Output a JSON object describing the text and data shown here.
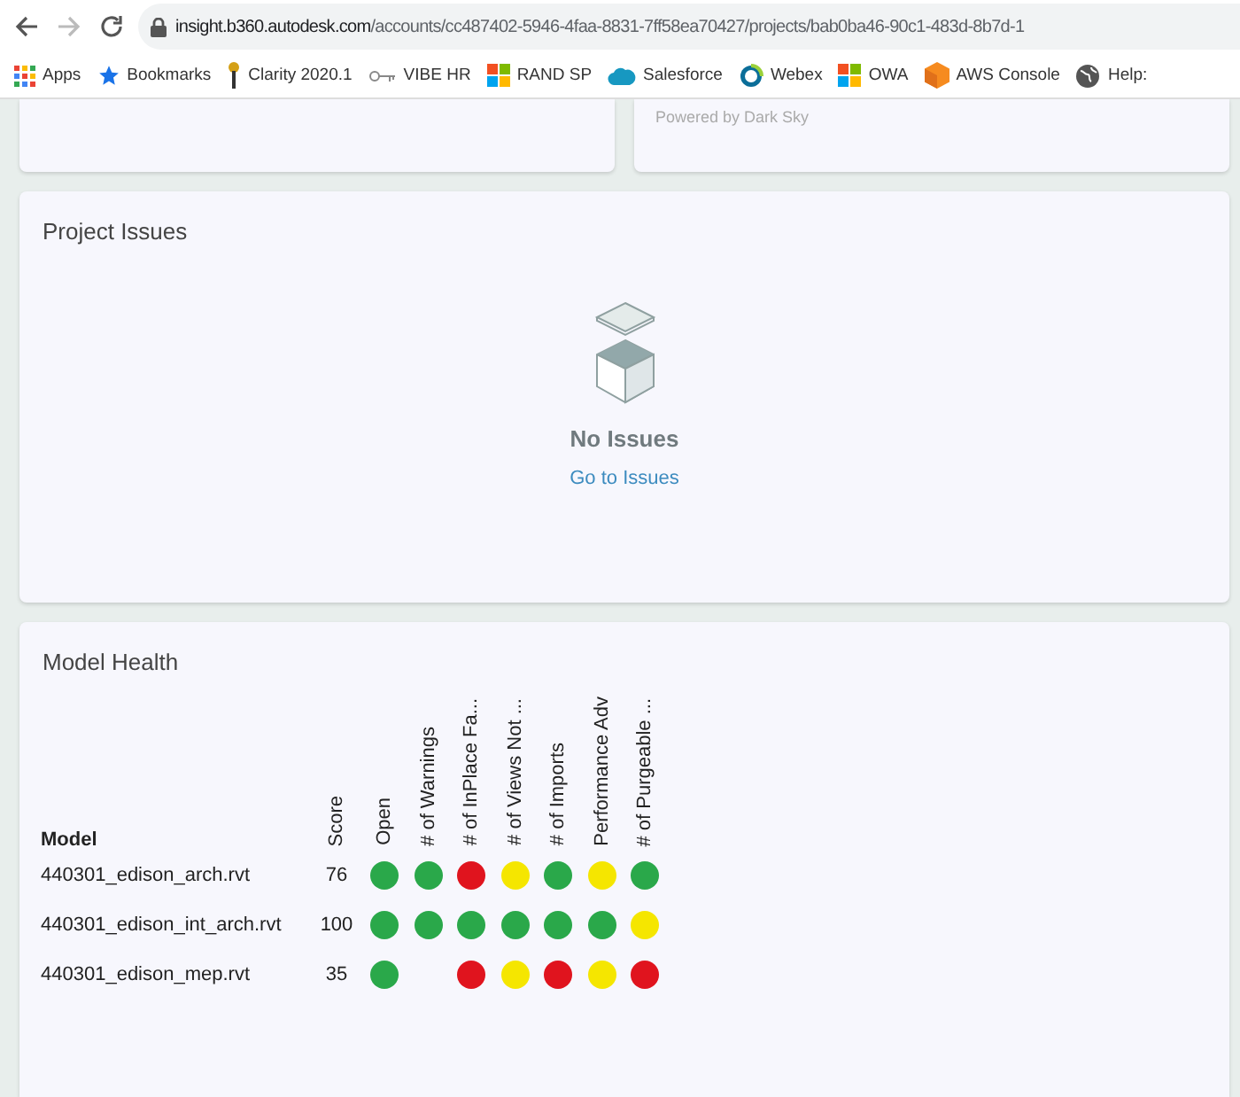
{
  "browser": {
    "url_host": "insight.b360.autodesk.com",
    "url_path": "/accounts/cc487402-5946-4faa-8831-7ff58ea70427/projects/bab0ba46-90c1-483d-8b7d-1",
    "bookmarks": [
      {
        "label": "Apps",
        "kind": "apps"
      },
      {
        "label": "Bookmarks",
        "kind": "star"
      },
      {
        "label": "Clarity 2020.1",
        "kind": "pin"
      },
      {
        "label": "VIBE HR",
        "kind": "key"
      },
      {
        "label": "RAND SP",
        "kind": "tiles"
      },
      {
        "label": "Salesforce",
        "kind": "cloud"
      },
      {
        "label": "Webex",
        "kind": "ring"
      },
      {
        "label": "OWA",
        "kind": "tiles"
      },
      {
        "label": "AWS Console",
        "kind": "cube"
      },
      {
        "label": "Help:",
        "kind": "globe"
      }
    ]
  },
  "weather_card": {
    "credit": "Powered by Dark Sky"
  },
  "issues_card": {
    "title": "Project Issues",
    "empty_title": "No Issues",
    "link": "Go to Issues"
  },
  "health_card": {
    "title": "Model Health",
    "model_header": "Model",
    "score_header": "Score",
    "columns": [
      "Open",
      "# of Warnings",
      "# of InPlace Fa...",
      "# of Views Not ...",
      "# of Imports",
      "Performance Adv",
      "# of Purgeable ..."
    ],
    "rows": [
      {
        "model": "440301_edison_arch.rvt",
        "score": "76",
        "cells": [
          {
            "kind": "dot",
            "color": "#2aa84a"
          },
          {
            "kind": "dot",
            "color": "#2aa84a"
          },
          {
            "kind": "dot",
            "color": "#e0141e"
          },
          {
            "kind": "dot",
            "color": "#f5e600"
          },
          {
            "kind": "dot",
            "color": "#2aa84a"
          },
          {
            "kind": "dot",
            "color": "#f5e600"
          },
          {
            "kind": "dot",
            "color": "#2aa84a"
          }
        ]
      },
      {
        "model": "440301_edison_int_arch.rvt",
        "score": "100",
        "cells": [
          {
            "kind": "dot",
            "color": "#2aa84a"
          },
          {
            "kind": "dot",
            "color": "#2aa84a"
          },
          {
            "kind": "dot",
            "color": "#2aa84a"
          },
          {
            "kind": "dot",
            "color": "#2aa84a"
          },
          {
            "kind": "dot",
            "color": "#2aa84a"
          },
          {
            "kind": "dot",
            "color": "#2aa84a"
          },
          {
            "kind": "dot",
            "color": "#f5e600"
          }
        ]
      },
      {
        "model": "440301_edison_mep.rvt",
        "score": "35",
        "cells": [
          {
            "kind": "dot",
            "color": "#2aa84a"
          },
          {
            "kind": "empty"
          },
          {
            "kind": "dot",
            "color": "#e0141e"
          },
          {
            "kind": "dot",
            "color": "#f5e600"
          },
          {
            "kind": "dot",
            "color": "#e0141e"
          },
          {
            "kind": "dot",
            "color": "#f5e600"
          },
          {
            "kind": "dot",
            "color": "#e0141e"
          }
        ]
      }
    ]
  }
}
